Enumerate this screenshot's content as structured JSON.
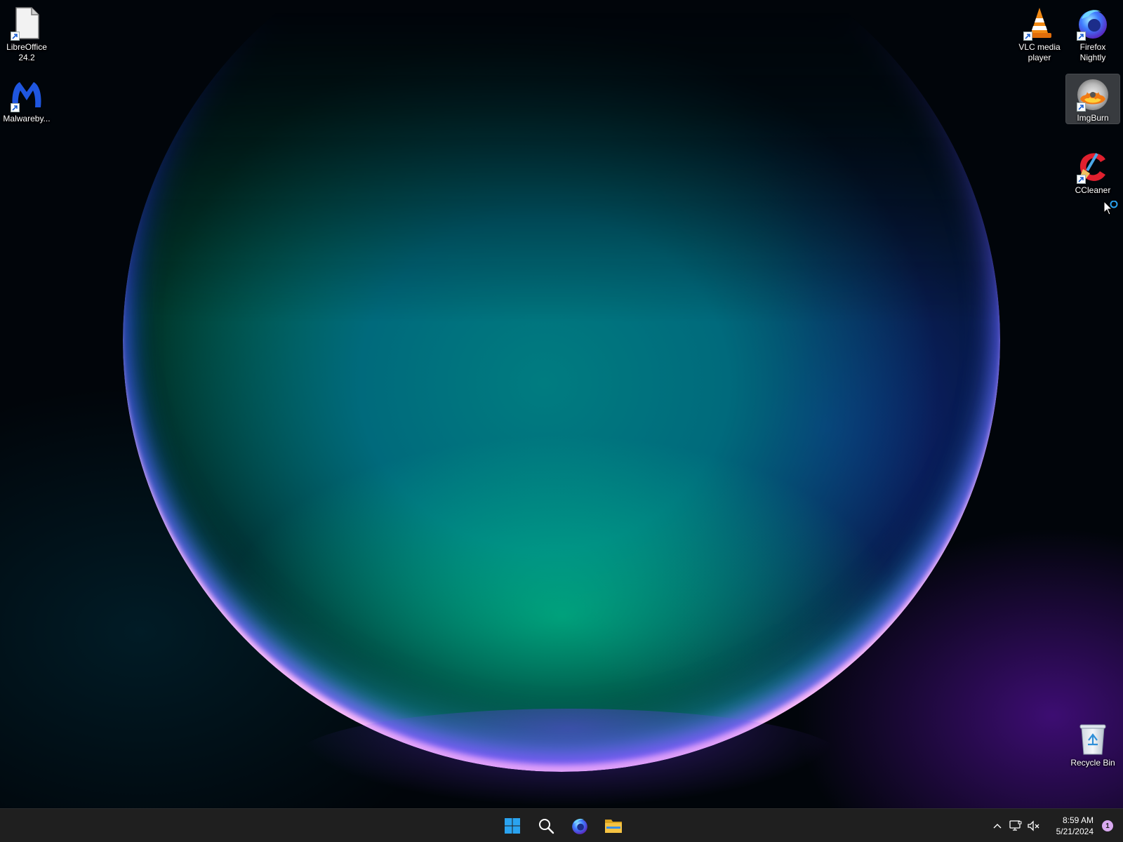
{
  "desktop": {
    "icons_left": [
      {
        "label": "LibreOffice\n24.2",
        "icon": "libreoffice-icon"
      },
      {
        "label": "Malwareby...",
        "icon": "malwarebytes-icon"
      }
    ],
    "icons_right": [
      {
        "label": "VLC media\nplayer",
        "icon": "vlc-icon"
      },
      {
        "label": "Firefox\nNightly",
        "icon": "firefox-nightly-icon"
      },
      {
        "label": "ImgBurn",
        "icon": "imgburn-icon",
        "selected": true
      },
      {
        "label": "CCleaner",
        "icon": "ccleaner-icon"
      },
      {
        "label": "Recycle Bin",
        "icon": "recycle-bin-icon"
      }
    ]
  },
  "taskbar": {
    "pinned": [
      {
        "name": "Start",
        "icon": "windows-start-icon"
      },
      {
        "name": "Search",
        "icon": "search-icon"
      },
      {
        "name": "Firefox Nightly",
        "icon": "firefox-nightly-icon"
      },
      {
        "name": "File Explorer",
        "icon": "file-explorer-icon"
      }
    ],
    "tray": {
      "time": "8:59 AM",
      "date": "5/21/2024",
      "notification_count": "1",
      "icons": [
        "chevron-up-icon",
        "network-icon",
        "volume-muted-icon"
      ]
    }
  },
  "colors": {
    "taskbar_bg": "#1f1f1f",
    "start_blue": "#2aa3f0",
    "explorer_yellow": "#f6c342"
  }
}
